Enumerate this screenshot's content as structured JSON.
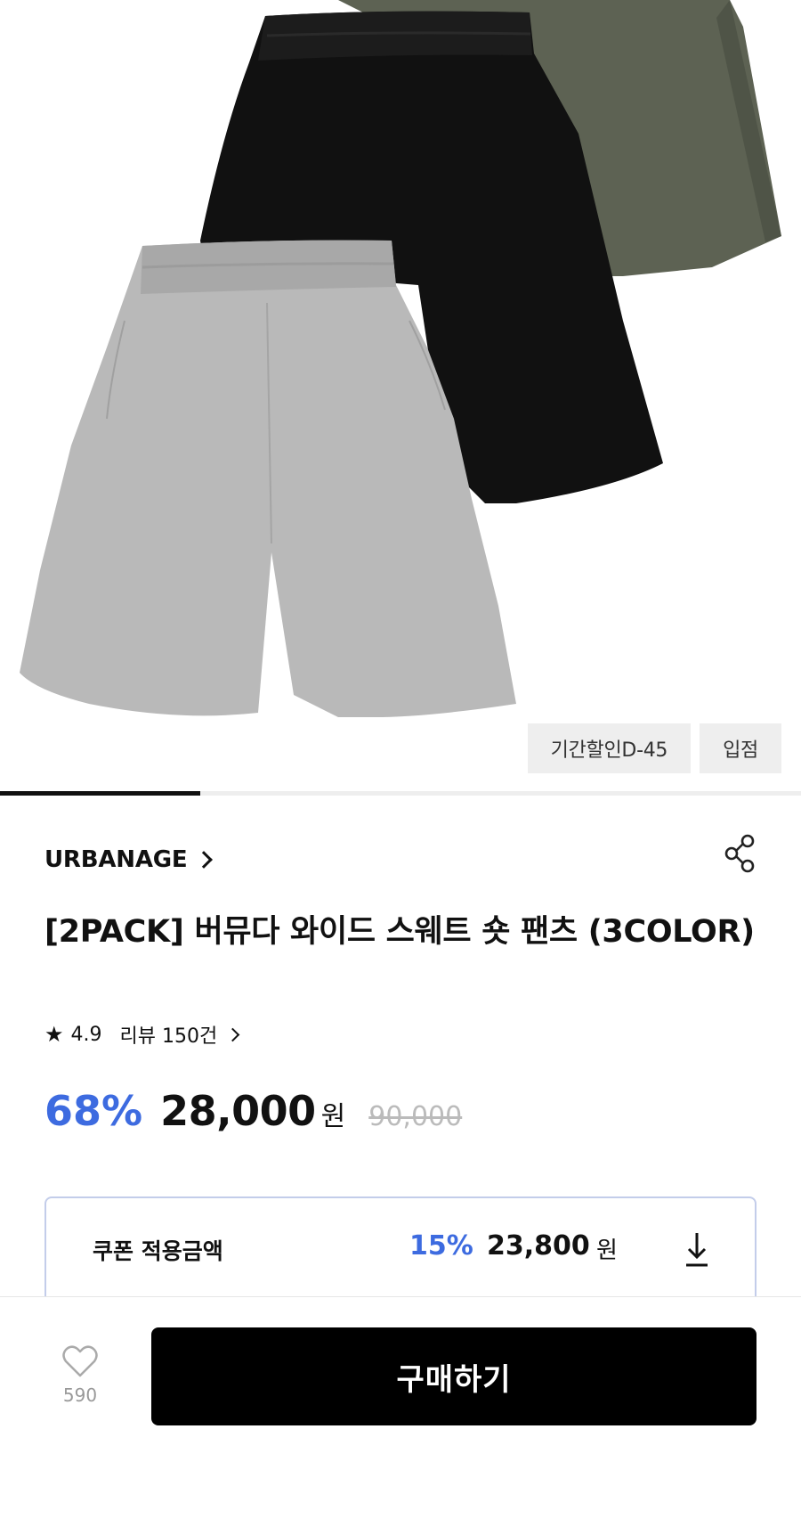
{
  "hero": {
    "image_alt": "",
    "badges": [
      "기간할인D-45",
      "입점"
    ],
    "carousel_progress": 0.25
  },
  "product": {
    "brand": "URBANAGE",
    "title": "[2PACK] 버뮤다 와이드 스웨트 숏 팬츠 (3COLOR)",
    "rating": "4.9",
    "review_text": "리뷰 150건",
    "discount": "68%",
    "price": "28,000",
    "currency": "원",
    "original_price": "90,000"
  },
  "coupon": {
    "label": "쿠폰 적용금액",
    "discount": "15%",
    "price": "23,800",
    "currency": "원"
  },
  "bottom_bar": {
    "wish_count": "590",
    "buy_label": "구매하기"
  },
  "colors": {
    "accent_blue": "#3d6be0",
    "buy_button": "#000000",
    "coupon_border": "#c3cdea"
  },
  "icons": [
    "star-icon",
    "share-icon",
    "download-icon",
    "heart-icon",
    "chevron-right-icon"
  ]
}
